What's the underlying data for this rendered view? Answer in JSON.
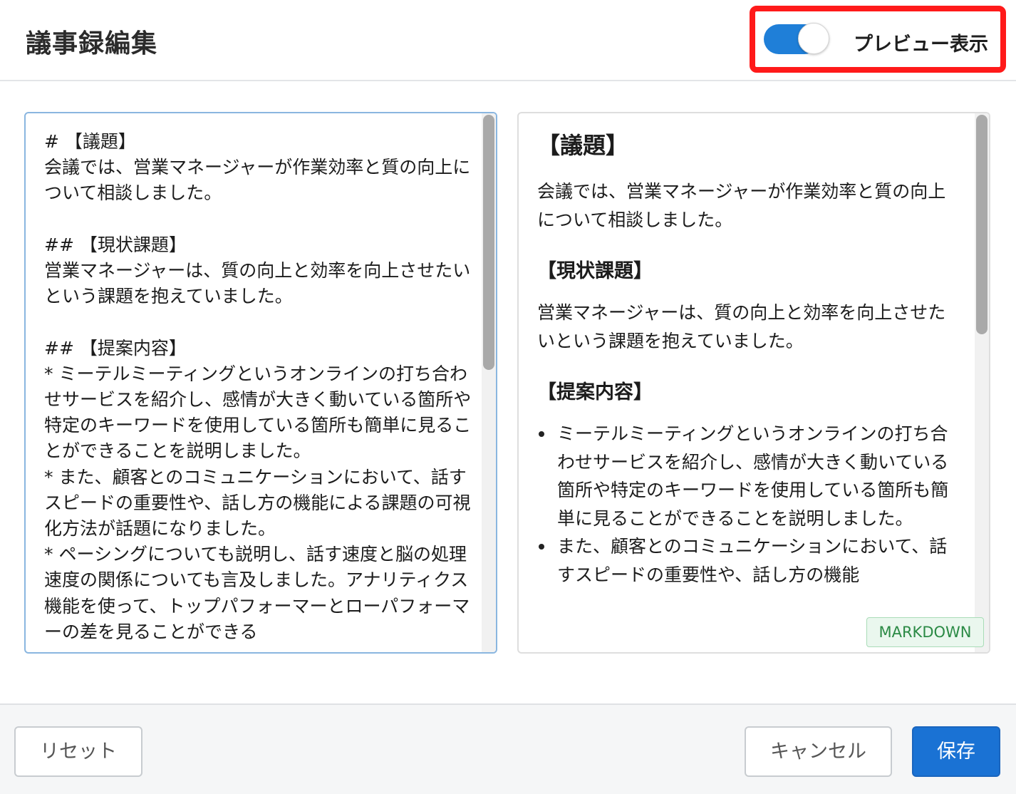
{
  "header": {
    "title": "議事録編集",
    "toggle_label": "プレビュー表示",
    "toggle_on": true,
    "accent_color": "#1f7fd8",
    "highlight_color": "#ff1a1a"
  },
  "editor": {
    "text": "# 【議題】\n会議では、営業マネージャーが作業効率と質の向上について相談しました。\n\n## 【現状課題】\n営業マネージャーは、質の向上と効率を向上させたいという課題を抱えていました。\n\n## 【提案内容】\n* ミーテルミーティングというオンラインの打ち合わせサービスを紹介し、感情が大きく動いている箇所や特定のキーワードを使用している箇所も簡単に見ることができることを説明しました。\n* また、顧客とのコミュニケーションにおいて、話すスピードの重要性や、話し方の機能による課題の可視化方法が話題になりました。\n* ペーシングについても説明し、話す速度と脳の処理速度の関係についても言及しました。アナリティクス機能を使って、トップパフォーマーとローパフォーマーの差を見ることができる"
  },
  "preview": {
    "heading1": "【議題】",
    "para1": "会議では、営業マネージャーが作業効率と質の向上について相談しました。",
    "heading2": "【現状課題】",
    "para2": "営業マネージャーは、質の向上と効率を向上させたいという課題を抱えていました。",
    "heading3": "【提案内容】",
    "list": [
      "ミーテルミーティングというオンラインの打ち合わせサービスを紹介し、感情が大きく動いている箇所や特定のキーワードを使用している箇所も簡単に見ることができることを説明しました。",
      "また、顧客とのコミュニケーションにおいて、話すスピードの重要性や、話し方の機能"
    ],
    "badge": "MARKDOWN"
  },
  "footer": {
    "reset_label": "リセット",
    "cancel_label": "キャンセル",
    "save_label": "保存"
  }
}
